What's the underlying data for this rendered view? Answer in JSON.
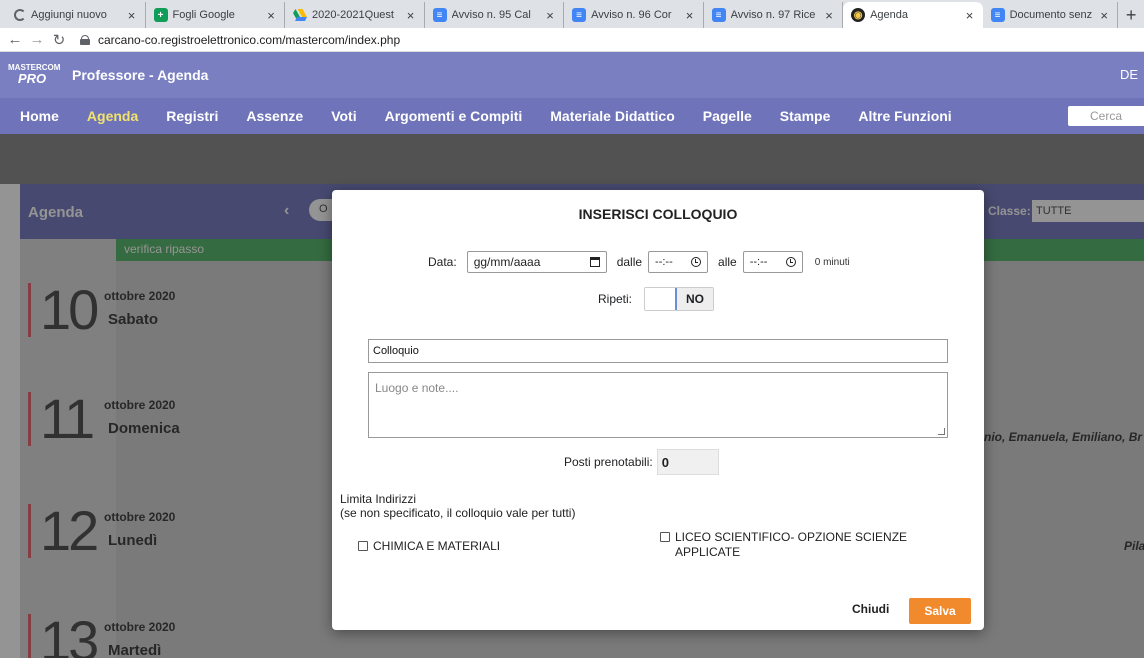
{
  "browser": {
    "tabs": [
      {
        "title": "Aggiungi nuovo",
        "icon": "loading-icon",
        "color": "#5f6368"
      },
      {
        "title": "Fogli Google",
        "icon": "sheets-icon",
        "color": "#0f9d58"
      },
      {
        "title": "2020-2021Quest",
        "icon": "drive-icon",
        "color": "#fbbc04"
      },
      {
        "title": "Avviso n. 95 Cal",
        "icon": "docs-icon",
        "color": "#4285f4"
      },
      {
        "title": "Avviso n. 96 Cor",
        "icon": "docs-icon",
        "color": "#4285f4"
      },
      {
        "title": "Avviso n. 97 Rice",
        "icon": "docs-icon",
        "color": "#4285f4"
      },
      {
        "title": "Agenda",
        "icon": "mastercom-icon",
        "color": "#222222",
        "active": true
      },
      {
        "title": "Documento senz",
        "icon": "docs-icon",
        "color": "#4285f4"
      }
    ],
    "url": "carcano-co.registroelettronico.com/mastercom/index.php"
  },
  "app": {
    "logo_top": "MASTERCOM",
    "logo_bottom": "PRO",
    "title": "Professore - Agenda",
    "user": "DE",
    "menu": [
      "Home",
      "Agenda",
      "Registri",
      "Assenze",
      "Voti",
      "Argomenti e Compiti",
      "Materiale Didattico",
      "Pagelle",
      "Stampe",
      "Altre Funzioni"
    ],
    "active_menu": "Agenda",
    "search_placeholder": "Cerca"
  },
  "agenda": {
    "label": "Agenda",
    "pill": "O",
    "class_label": "Classe:",
    "class_value": "TUTTE",
    "event_banner": "verifica ripasso",
    "days": [
      {
        "num": "10",
        "month": "ottobre 2020",
        "weekday": "Sabato"
      },
      {
        "num": "11",
        "month": "ottobre 2020",
        "weekday": "Domenica"
      },
      {
        "num": "12",
        "month": "ottobre 2020",
        "weekday": "Lunedì"
      },
      {
        "num": "13",
        "month": "ottobre 2020",
        "weekday": "Martedì"
      }
    ],
    "side_names_1": "nio, Emanuela, Emiliano, Br",
    "side_names_2": "Pila"
  },
  "modal": {
    "title": "INSERISCI COLLOQUIO",
    "date_label": "Data:",
    "date_placeholder": "gg/mm/aaaa",
    "from_label": "dalle",
    "to_label": "alle",
    "time_placeholder": "--:--",
    "duration": "0 minuti",
    "repeat_label": "Ripeti:",
    "repeat_value": "NO",
    "title_value": "Colloquio",
    "notes_placeholder": "Luogo e note....",
    "seats_label": "Posti prenotabili:",
    "seats_value": "0",
    "limit_title": "Limita Indirizzi",
    "limit_note": "(se non specificato, il colloquio vale per tutti)",
    "options": [
      "CHIMICA E MATERIALI",
      "LICEO SCIENTIFICO- OPZIONE SCIENZE APPLICATE"
    ],
    "close_label": "Chiudi",
    "save_label": "Salva",
    "accent": "#f08a2c"
  }
}
